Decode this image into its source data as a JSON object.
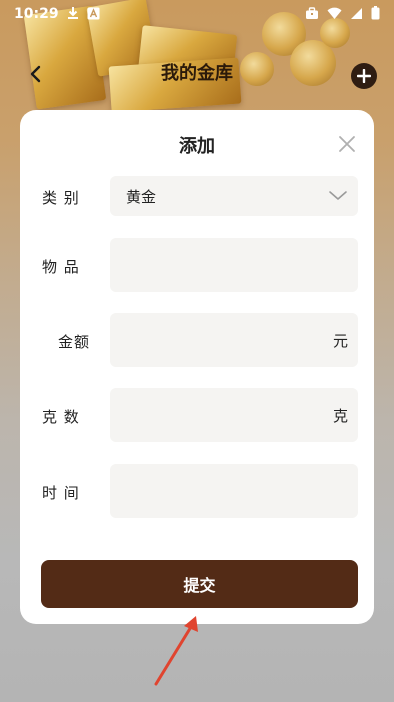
{
  "status_bar": {
    "time": "10:29",
    "icons": [
      "download-icon",
      "a-box-icon",
      "briefcase-icon",
      "wifi-icon",
      "signal-icon",
      "battery-icon"
    ]
  },
  "nav": {
    "title": "我的金库",
    "back_icon": "chevron-left-icon",
    "add_icon": "plus-circle-icon"
  },
  "modal": {
    "title": "添加",
    "close_icon": "close-icon",
    "fields": {
      "category": {
        "label": "类 别",
        "value": "黄金"
      },
      "item": {
        "label": "物 品",
        "value": ""
      },
      "amount": {
        "label": "金额",
        "value": "",
        "unit": "元"
      },
      "grams": {
        "label": "克 数",
        "value": "",
        "unit": "克"
      },
      "time": {
        "label": "时 间",
        "value": ""
      }
    },
    "submit_label": "提交"
  },
  "colors": {
    "primary": "#532b16",
    "annotation_arrow": "#e0442f",
    "field_bg": "#f5f4f2"
  }
}
